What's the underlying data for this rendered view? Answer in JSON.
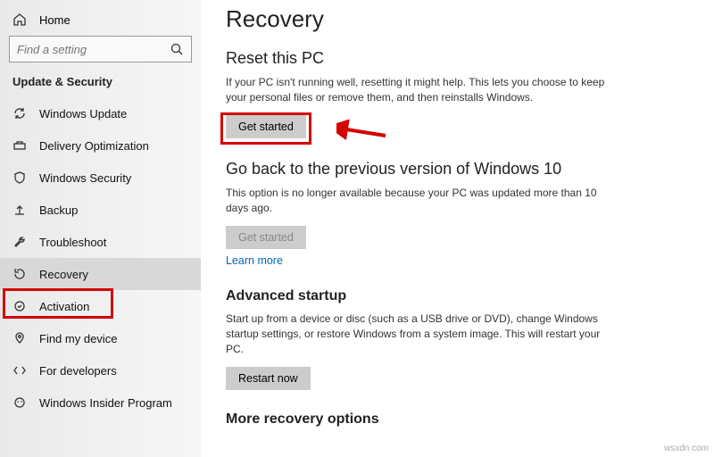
{
  "sidebar": {
    "home": "Home",
    "search_placeholder": "Find a setting",
    "section": "Update & Security",
    "items": [
      {
        "label": "Windows Update"
      },
      {
        "label": "Delivery Optimization"
      },
      {
        "label": "Windows Security"
      },
      {
        "label": "Backup"
      },
      {
        "label": "Troubleshoot"
      },
      {
        "label": "Recovery"
      },
      {
        "label": "Activation"
      },
      {
        "label": "Find my device"
      },
      {
        "label": "For developers"
      },
      {
        "label": "Windows Insider Program"
      }
    ]
  },
  "page": {
    "title": "Recovery",
    "reset": {
      "heading": "Reset this PC",
      "desc": "If your PC isn't running well, resetting it might help. This lets you choose to keep your personal files or remove them, and then reinstalls Windows.",
      "button": "Get started"
    },
    "goback": {
      "heading": "Go back to the previous version of Windows 10",
      "desc": "This option is no longer available because your PC was updated more than 10 days ago.",
      "button": "Get started",
      "link": "Learn more"
    },
    "advanced": {
      "heading": "Advanced startup",
      "desc": "Start up from a device or disc (such as a USB drive or DVD), change Windows startup settings, or restore Windows from a system image. This will restart your PC.",
      "button": "Restart now"
    },
    "more": {
      "heading": "More recovery options"
    }
  },
  "watermark": "wsxdn.com"
}
